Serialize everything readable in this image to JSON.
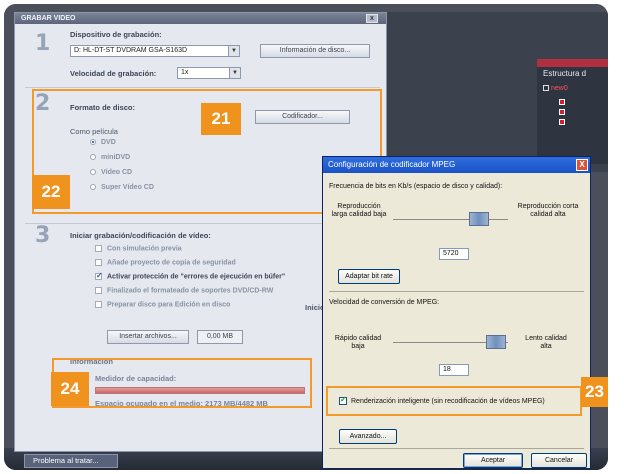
{
  "background": {
    "estructura_title": "Estructura d",
    "estructura_item": "new0",
    "taskbar_button": "Problema al tratar..."
  },
  "grabar_dialog": {
    "title": "GRABAR VIDEO",
    "close_label": "x",
    "step1": {
      "number": "1",
      "device_label": "Dispositivo de grabación:",
      "device_value": "D: HL-DT-ST DVDRAM GSA-S163D",
      "disc_info_button": "Información de disco...",
      "speed_label": "Velocidad de grabación:",
      "speed_value": "1x"
    },
    "step2": {
      "number": "2",
      "format_label": "Formato de disco:",
      "codificador_button": "Codificador...",
      "como_pelicula": "Como película",
      "options": [
        "DVD",
        "miniDVD",
        "Vídeo CD",
        "Super Vídeo CD"
      ],
      "selected_index": 0
    },
    "step3": {
      "number": "3",
      "title": "Iniciar grabación/codificación de vídeo:",
      "checkboxes": [
        {
          "label": "Con simulación previa",
          "checked": false,
          "active": false
        },
        {
          "label": "Añade proyecto de copia de seguridad",
          "checked": false,
          "active": false
        },
        {
          "label": "Activar protección de \"errores de ejecución en búfer\"",
          "checked": true,
          "active": true
        },
        {
          "label": "Finalizado el formateado de soportes DVD/CD-RW",
          "checked": false,
          "active": false
        },
        {
          "label": "Preparar disco para Edición en disco",
          "checked": false,
          "active": false
        }
      ],
      "inicio_fragment": "Inicio",
      "insert_button": "Insertar archivos...",
      "size_value": "0,00 MB"
    },
    "info": {
      "header": "Información",
      "capacity_label": "Medidor de capacidad:",
      "used_space": "Espacio ocupado en el medio: 2173 MB/4482 MB"
    }
  },
  "badges": {
    "b21": "21",
    "b22": "22",
    "b23": "23",
    "b24": "24"
  },
  "mpeg_dialog": {
    "title": "Configuración de codificador MPEG",
    "close_label": "X",
    "bitrate_label": "Frecuencia de bits en Kb/s (espacio de disco y calidad):",
    "left_label_1": "Reproducción larga calidad baja",
    "right_label_1": "Reproducción corta calidad alta",
    "bitrate_value": "5720",
    "adapt_button": "Adaptar bit rate",
    "speed_label": "Velocidad de conversión de MPEG:",
    "left_label_2": "Rápido calidad baja",
    "right_label_2": "Lento calidad alta",
    "speed_value": "18",
    "smart_render_label": "Renderización inteligente (sin recodificación de vídeos MPEG)",
    "smart_render_checked": true,
    "advanced_button": "Avanzado...",
    "accept_button": "Aceptar",
    "cancel_button": "Cancelar"
  },
  "colors": {
    "accent_orange": "#f0931e",
    "xp_title_blue": "#1a52c4"
  }
}
